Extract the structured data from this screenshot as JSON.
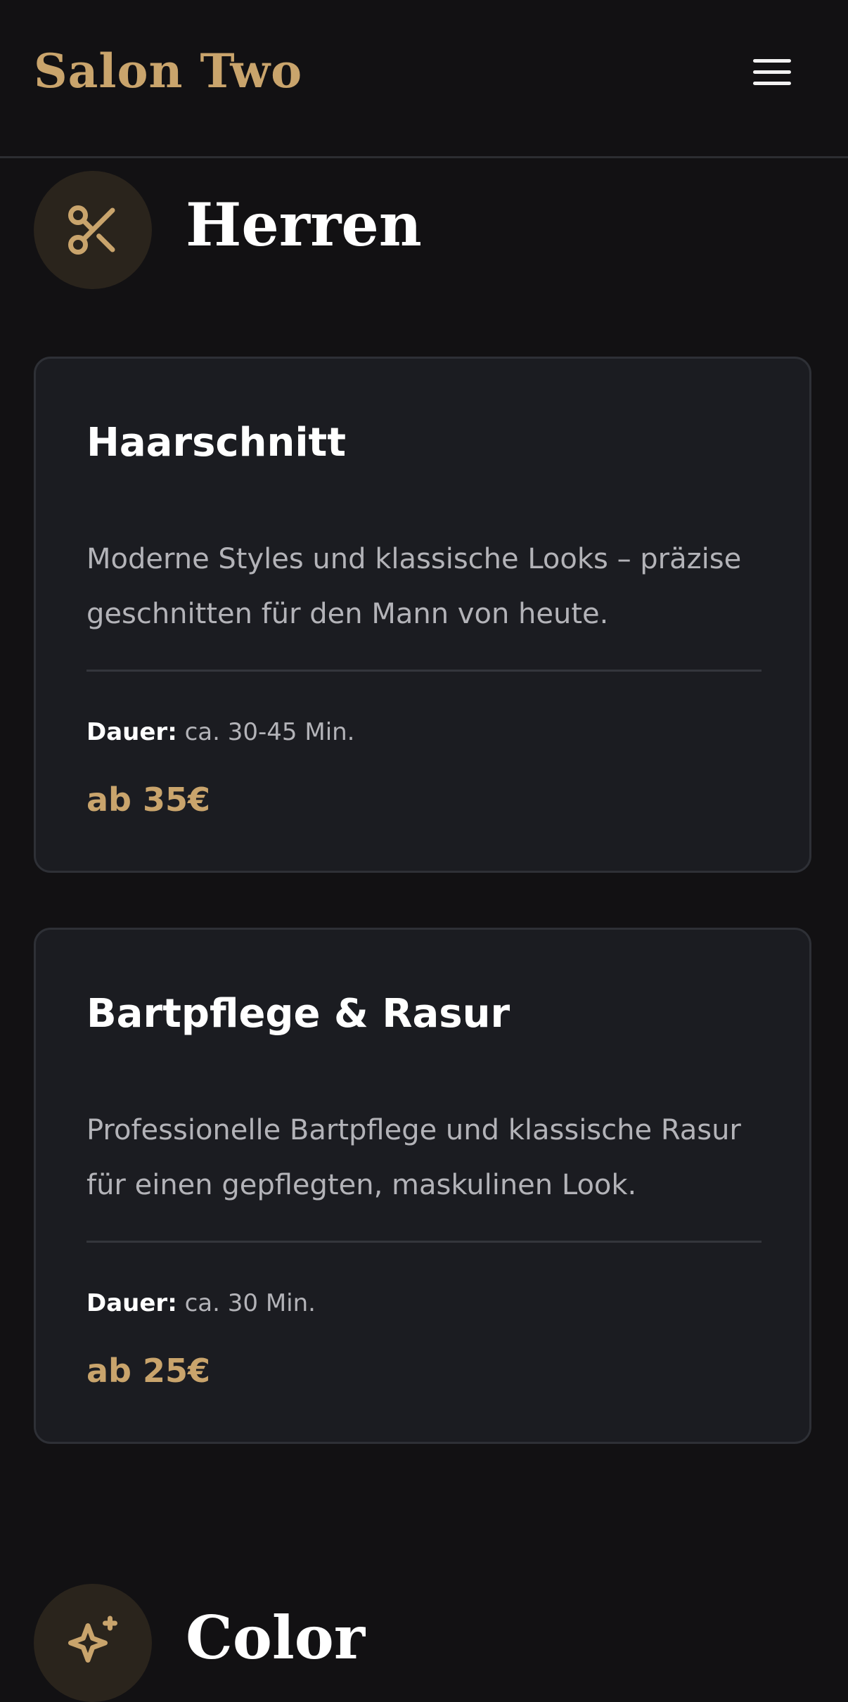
{
  "header": {
    "logo": "Salon Two",
    "menu_icon": "hamburger-menu-icon"
  },
  "sections": [
    {
      "title": "Herren",
      "icon": "scissors-icon",
      "services": [
        {
          "title": "Haarschnitt",
          "description": "Moderne Styles und klassische Looks – präzise geschnitten für den Mann von heute.",
          "duration_label": "Dauer:",
          "duration_value": "ca. 30-45 Min.",
          "price": "ab 35€"
        },
        {
          "title": "Bartpflege & Rasur",
          "description": "Professionelle Bartpflege und klassische Rasur für einen gepflegten, maskulinen Look.",
          "duration_label": "Dauer:",
          "duration_value": "ca. 30 Min.",
          "price": "ab 25€"
        }
      ]
    },
    {
      "title": "Color",
      "icon": "sparkles-icon"
    }
  ],
  "colors": {
    "background": "#121113",
    "card": "#1b1c21",
    "accent_gold": "#c9a46c",
    "icon_circle": "#2a241c"
  }
}
